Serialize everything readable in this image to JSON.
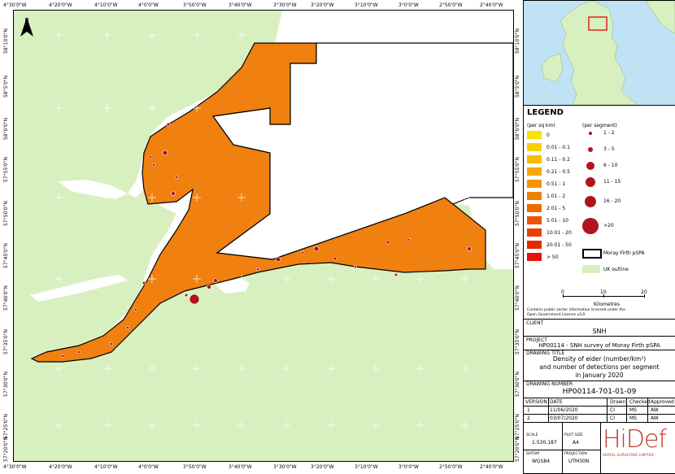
{
  "map": {
    "north_label": "N",
    "x_ticks": [
      "4°30'0\"W",
      "4°20'0\"W",
      "4°10'0\"W",
      "4°0'0\"W",
      "3°50'0\"W",
      "3°40'0\"W",
      "3°30'0\"W",
      "3°20'0\"W",
      "3°10'0\"W",
      "3°0'0\"W",
      "2°50'0\"W",
      "2°40'0\"W"
    ],
    "y_ticks": [
      "58°10'0\"N",
      "58°5'0\"N",
      "58°0'0\"N",
      "57°55'0\"N",
      "57°50'0\"N",
      "57°45'0\"N",
      "57°40'0\"N",
      "57°35'0\"N",
      "57°30'0\"N",
      "57°25'0\"N",
      "57°20'0\"N"
    ],
    "colors": {
      "land": "#d8f0c0",
      "sea": "#ffffff",
      "density_fill": "#f08010",
      "detection": "#b0141c"
    }
  },
  "legend": {
    "title": "LEGEND",
    "density_header": "(per sq km)",
    "segment_header": "(per segment)",
    "density_classes": [
      {
        "label": "0",
        "color": "#f5e400"
      },
      {
        "label": "0.01 - 0.1",
        "color": "#f7d000"
      },
      {
        "label": "0.11 - 0.2",
        "color": "#f7bc00"
      },
      {
        "label": "0.21 - 0.5",
        "color": "#f5a800"
      },
      {
        "label": "0.51 - 1",
        "color": "#f39400"
      },
      {
        "label": "1.01 - 2",
        "color": "#f28000"
      },
      {
        "label": "2.01 - 5",
        "color": "#f06a00"
      },
      {
        "label": "5.01 - 10",
        "color": "#ee5400"
      },
      {
        "label": "10.01 - 20",
        "color": "#ec3e00"
      },
      {
        "label": "20.01 - 50",
        "color": "#ea2800"
      },
      {
        "label": "> 50",
        "color": "#e81010"
      }
    ],
    "segment_classes": [
      "1 - 2",
      "3 - 5",
      "6 - 10",
      "11 - 15",
      "16 - 20",
      ">20"
    ],
    "boundary_label": "Moray Firth pSPA",
    "uk_label": "UK outline",
    "scale_ticks": [
      "0",
      "10",
      "20"
    ],
    "scale_unit": "Kilometres",
    "credit_1": "Contains public sector information licensed under the",
    "credit_2": "Open Government Licence v3.0"
  },
  "title_block": {
    "client_label": "CLIENT",
    "client": "SNH",
    "project_label": "PROJECT",
    "project": "HP00114 - SNH survey of Moray Firth pSPA",
    "drawing_title_label": "DRAWING TITLE",
    "drawing_title_1": "Density of eider (number/km²)",
    "drawing_title_2": "and number of detections per segment",
    "drawing_title_3": "in January 2020",
    "drawing_number_label": "DRAWING NUMBER",
    "drawing_number": "HP00114-701-01-09",
    "version_headers": [
      "VERSION",
      "DATE",
      "Drawn",
      "Checked",
      "Approved"
    ],
    "versions": [
      [
        "1",
        "11/06/2020",
        "CI",
        "MS",
        "AW"
      ],
      [
        "2",
        "03/07/2020",
        "CI",
        "MS",
        "AW"
      ]
    ],
    "scale_label": "SCALE",
    "scale": "1:530,187",
    "plot_size_label": "PLOT SIZE",
    "plot_size": "A4",
    "datum_label": "DATUM",
    "datum": "WGS84",
    "projection_label": "PROJECTION",
    "projection": "UTM30N",
    "logo_text": "HiDef",
    "logo_sub": "AERIAL SURVEYING LIMITED"
  }
}
